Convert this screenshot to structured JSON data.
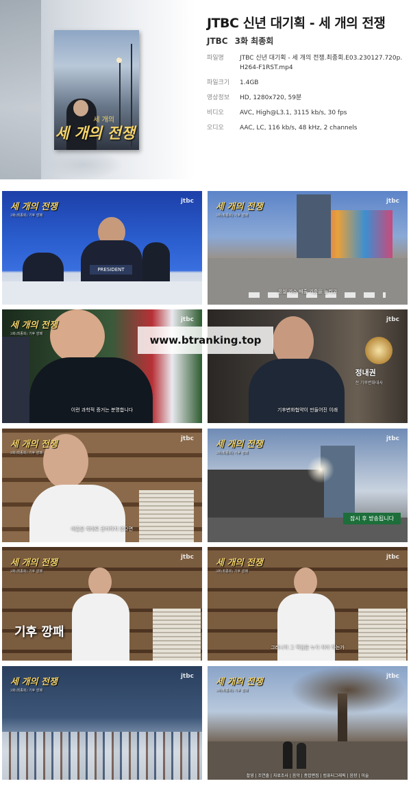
{
  "header": {
    "title": "JTBC 신년 대기획 - 세 개의 전쟁",
    "channel": "JTBC",
    "episode": "3화 최종회",
    "poster_title": "세 개의 전쟁",
    "poster_sub": "세 개의"
  },
  "meta": [
    {
      "key": "파일명",
      "value": "JTBC 신년 대기획 - 세 개의 전쟁.최종회.E03.230127.720p.H264-F1RST.mp4"
    },
    {
      "key": "파일크기",
      "value": "1.4GB"
    },
    {
      "key": "영상정보",
      "value": "HD, 1280x720, 59분"
    },
    {
      "key": "비디오",
      "value": "AVC, High@L3.1, 3115 kb/s, 30 fps"
    },
    {
      "key": "오디오",
      "value": "AAC, LC, 116 kb/s, 48 kHz, 2 channels"
    }
  ],
  "frames": {
    "logo": "세 개의 전쟁",
    "logo_sub": "3화(최종회) 기후 깡패",
    "jtbc": "jtbc",
    "f1_plate": "PRESIDENT",
    "f2_sub": "온실 가스 배출 기준을 늘리고",
    "f3_sub": "이런 과학적 증거는 분명합니다",
    "f4_name": "정내권",
    "f4_role": "전 기후변화대사",
    "f4_sub": "기후변화협약이 만들어진 이래",
    "f5_sub": "배출을 제대로 관리하지 않으면",
    "f6_banner": "잠시 후 방송됩니다",
    "f7_caption_a": "기후",
    "f7_caption_b": "깡패",
    "f8_sub": "그러니까 그 책임을 누가 져야 하는가",
    "f10_credit": "촬영 | 조연출 | 자료조사 | 음악 | 종합편집 | 컴퓨터그래픽 | 음향 | 미술"
  },
  "watermark": "www.btranking.top",
  "colors": {
    "poster_title": "#f3d36a",
    "banner_green": "#1d6e3a"
  }
}
